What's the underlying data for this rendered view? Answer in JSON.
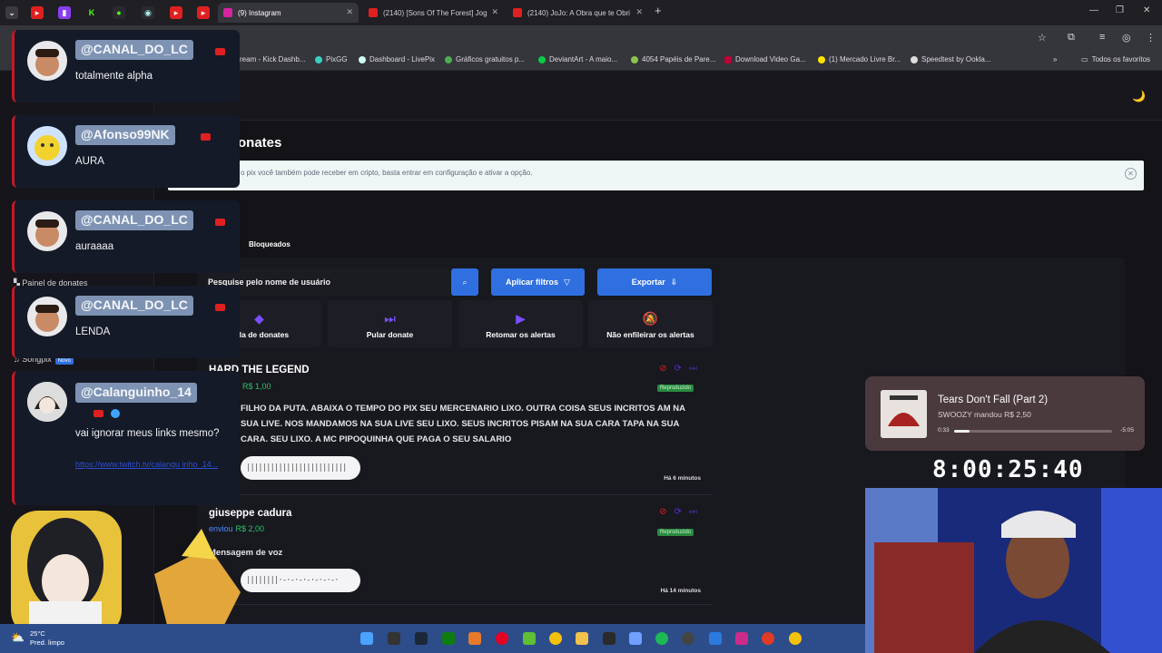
{
  "browser": {
    "tabs": [
      {
        "label": "(9) Instagram",
        "active": true
      },
      {
        "label": "(2140) [Sons Of The Forest] Jog"
      },
      {
        "label": "(2140) JoJo: A Obra que te Obri"
      }
    ],
    "bookmarks": [
      "ream - Kick Dashb...",
      "PixGG",
      "Dashboard - LivePix",
      "Gráficos gratuitos p...",
      "DeviantArt - A maio...",
      "4054 Papéis de Pare...",
      "Download Video Ga...",
      "(1) Mercado Livre Br...",
      "Speedtest by Ookla...",
      "Todos os favoritos"
    ]
  },
  "page": {
    "title": "onates",
    "info_text": "o pix você também pode receber em cripto, basta entrar em configuração e ativar a opção.",
    "tab_blocked": "Bloqueados",
    "search_placeholder": "Pesquise pelo nome de usuário",
    "apply_filters": "Aplicar filtros",
    "export": "Exportar",
    "nav_donates": "Painel de donates",
    "nav_songpix": "Songpix",
    "nav_songpix_badge": "Novo",
    "actions": [
      "r fila de donates",
      "Pular donate",
      "Retomar os alertas",
      "Não enfileirar os alertas"
    ],
    "donates": [
      {
        "name": "HARD THE LEGEND",
        "sent": "",
        "amount": "R$ 1,00",
        "message": "FILHO DA PUTA. ABAIXA O TEMPO DO PIX SEU MERCENARIO LIXO. OUTRA COISA SEUS INCRITOS AM NA SUA LIVE. NOS MANDAMOS NA SUA LIVE SEU LIXO. SEUS INCRITOS PISAM NA SUA CARA TAPA NA SUA CARA. SEU LIXO. A MC PIPOQUINHA QUE PAGA O SEU SALARIO",
        "status": "Reproduzido",
        "time": "Há 6 minutos"
      },
      {
        "name": "giuseppe cadura",
        "sent": "enviou",
        "amount": "R$ 2,00",
        "message": "Mensagem de voz",
        "status": "Reproduzido",
        "time": "Há 14 minutos"
      }
    ]
  },
  "chat": [
    {
      "handle": "@CANAL_DO_LC",
      "message": "totalmente alpha"
    },
    {
      "handle": "@Afonso99NK",
      "message": "AURA"
    },
    {
      "handle": "@CANAL_DO_LC",
      "message": "auraaaa"
    },
    {
      "handle": "@CANAL_DO_LC",
      "message": "LENDA"
    },
    {
      "handle": "@Calanguinho_14",
      "message": "vai ignorar meus links mesmo?",
      "link": "https://www.twitch.tv/calangu inho_14..."
    }
  ],
  "music": {
    "title": "Tears Don't Fall (Part 2)",
    "subtitle": "SWOOZY mandou R$ 2,50",
    "elapsed": "0:33",
    "remaining": "-5:05",
    "progress": 0.1
  },
  "timer": "8:00:25:40",
  "weather": {
    "temp": "25°C",
    "desc": "Pred. limpo"
  }
}
